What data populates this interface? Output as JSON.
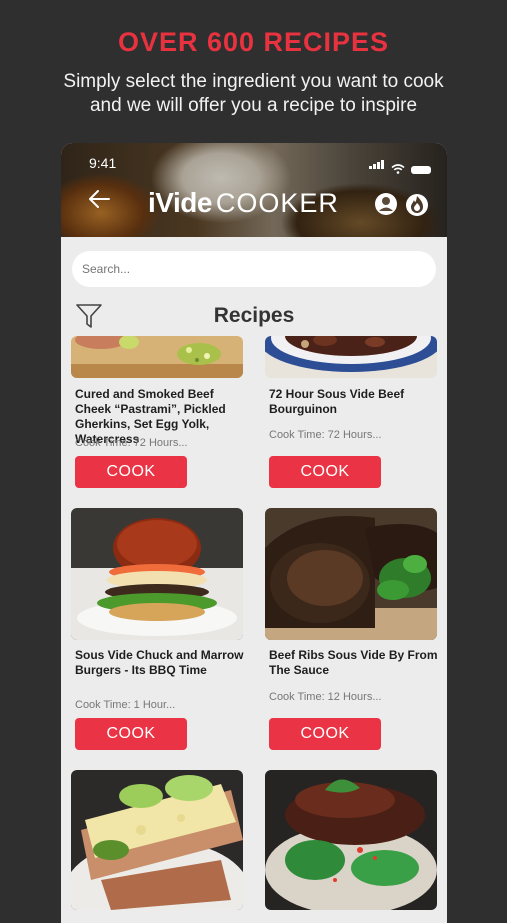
{
  "promo": {
    "headline": "OVER 600 RECIPES",
    "sub_line1": "Simply select the ingredient you want to cook",
    "sub_line2": "and we will offer you a recipe to inspire"
  },
  "status_bar": {
    "time": "9:41"
  },
  "app": {
    "logo_bold": "iVide",
    "logo_light": "COOKER"
  },
  "search": {
    "placeholder": "Search..."
  },
  "page": {
    "title": "Recipes"
  },
  "cook_label": "COOK",
  "recipes": [
    {
      "title": "Cured and Smoked Beef Cheek “Pastrami”, Pickled Gherkins, Set Egg Yolk, Watercress",
      "time": "Cook Time: 72 Hours..."
    },
    {
      "title": "72 Hour Sous Vide Beef Bourguinon",
      "time": "Cook Time: 72 Hours..."
    },
    {
      "title": "Sous Vide Chuck and Marrow Burgers - Its BBQ Time",
      "time": "Cook Time: 1 Hour..."
    },
    {
      "title": "Beef Ribs Sous Vide By From The Sauce",
      "time": "Cook Time: 12 Hours..."
    }
  ],
  "colors": {
    "accent": "#ea3445",
    "headline": "#e8323f",
    "background": "#2f2f2f",
    "screen": "#ececec"
  },
  "icons": [
    "back-arrow-icon",
    "user-icon",
    "fire-icon",
    "filter-icon"
  ]
}
